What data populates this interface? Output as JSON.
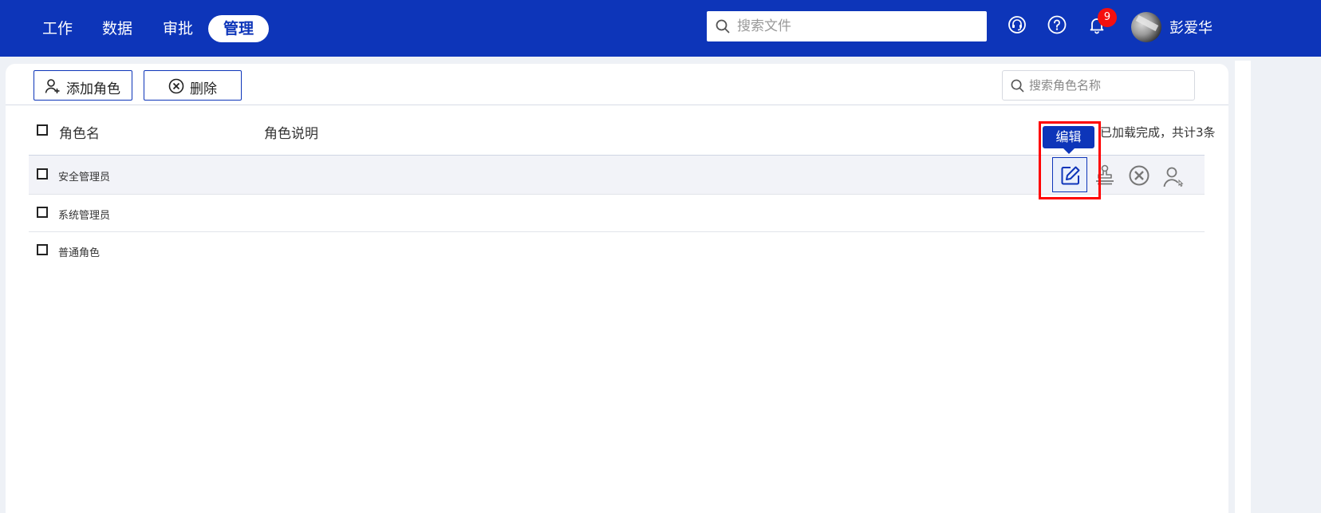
{
  "topbar": {
    "nav": [
      "工作",
      "数据",
      "审批",
      "管理"
    ],
    "active_nav": "管理",
    "search_placeholder": "搜索文件",
    "notification_count": "9",
    "username": "彭爱华",
    "icons": [
      "headset-icon",
      "help-icon",
      "bell-icon",
      "avatar"
    ],
    "brand_color": "#0d35b9"
  },
  "toolbar": {
    "add_role_label": "添加角色",
    "delete_label": "删除",
    "role_search_placeholder": "搜索角色名称"
  },
  "table": {
    "columns": [
      "角色名",
      "角色说明"
    ],
    "status": "已加载完成，共计3条",
    "rows": [
      {
        "name": "安全管理员"
      },
      {
        "name": "系统管理员"
      },
      {
        "name": "普通角色"
      }
    ],
    "row_actions": [
      "edit-icon",
      "stamp-icon",
      "delete-icon",
      "user-pointer-icon"
    ],
    "tooltip": "编辑"
  },
  "colors": {
    "highlight": "#ff0000",
    "badge": "#f50f0f",
    "hover_row": "#f2f3f8"
  }
}
